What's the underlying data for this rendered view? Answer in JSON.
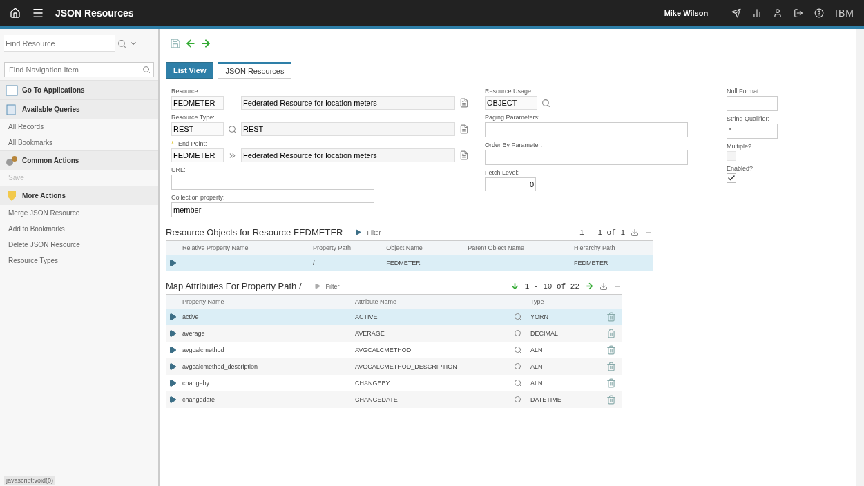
{
  "header": {
    "title": "JSON Resources",
    "user": "Mike Wilson",
    "brand": "IBM"
  },
  "toolbar": {
    "find_placeholder": "Find Resource"
  },
  "sidebar": {
    "search_placeholder": "Find Navigation Item",
    "sections": [
      {
        "title": "Go To Applications"
      },
      {
        "title": "Available Queries",
        "items": [
          {
            "label": "All Records",
            "disabled": false
          },
          {
            "label": "All Bookmarks",
            "disabled": false
          }
        ]
      },
      {
        "title": "Common Actions",
        "items": [
          {
            "label": "Save",
            "disabled": true
          }
        ]
      },
      {
        "title": "More Actions",
        "items": [
          {
            "label": "Merge JSON Resource",
            "disabled": false
          },
          {
            "label": "Add to Bookmarks",
            "disabled": false
          },
          {
            "label": "Delete JSON Resource",
            "disabled": false
          },
          {
            "label": "Resource Types",
            "disabled": false
          }
        ]
      }
    ],
    "status": "javascript:void(0)"
  },
  "tabs": [
    {
      "label": "List View",
      "selected": false
    },
    {
      "label": "JSON Resources",
      "selected": true
    }
  ],
  "form": {
    "left": [
      {
        "label": "Resource:",
        "code": "FEDMETER",
        "description": "Federated Resource for location meters",
        "kind": "coded"
      },
      {
        "label": "Resource Type:",
        "code": "REST",
        "description": "REST",
        "kind": "lookup"
      },
      {
        "label": "End Point:",
        "marker": "*",
        "code": "FEDMETER",
        "description": "Federated Resource for location meters",
        "kind": "linked"
      },
      {
        "label": "URL:",
        "kind": "text"
      },
      {
        "label": "Collection property:",
        "value": "member",
        "kind": "text"
      }
    ],
    "middle": [
      {
        "label": "Resource Usage:",
        "value": "OBJECT",
        "kind": "lookup"
      },
      {
        "label": "Paging Parameters:",
        "kind": "text"
      },
      {
        "label": "Order By Parameter:",
        "kind": "text"
      },
      {
        "label": "Fetch Level:",
        "value": "0",
        "kind": "number"
      }
    ],
    "right": [
      {
        "label": "Null Format:",
        "kind": "text"
      },
      {
        "label": "String Qualifier:",
        "value": "\"",
        "kind": "text"
      },
      {
        "label": "Multiple?",
        "checked": false,
        "disabled": true,
        "kind": "checkbox"
      },
      {
        "label": "Enabled?",
        "checked": true,
        "disabled": false,
        "kind": "checkbox"
      }
    ]
  },
  "objects_table": {
    "title": "Resource Objects for Resource FEDMETER",
    "filter": "Filter",
    "range": "1 - 1 of 1",
    "columns": [
      "Relative Property Name",
      "Property Path",
      "Object Name",
      "Parent Object Name",
      "Hierarchy Path"
    ],
    "rows": [
      {
        "cells": [
          "",
          "/",
          "FEDMETER",
          "",
          "FEDMETER"
        ],
        "selected": true
      }
    ]
  },
  "attributes_table": {
    "title": "Map Attributes For Property Path /",
    "filter": "Filter",
    "range": "1 - 10 of 22",
    "columns": [
      "Property Name",
      "Attribute Name",
      "Type"
    ],
    "rows": [
      {
        "property": "active",
        "attribute": "ACTIVE",
        "type": "YORN",
        "selected": true
      },
      {
        "property": "average",
        "attribute": "AVERAGE",
        "type": "DECIMAL",
        "selected": false
      },
      {
        "property": "avgcalcmethod",
        "attribute": "AVGCALCMETHOD",
        "type": "ALN",
        "selected": false
      },
      {
        "property": "avgcalcmethod_description",
        "attribute": "AVGCALCMETHOD_DESCRIPTION",
        "type": "ALN",
        "selected": false
      },
      {
        "property": "changeby",
        "attribute": "CHANGEBY",
        "type": "ALN",
        "selected": false
      },
      {
        "property": "changedate",
        "attribute": "CHANGEDATE",
        "type": "DATETIME",
        "selected": false
      }
    ]
  }
}
